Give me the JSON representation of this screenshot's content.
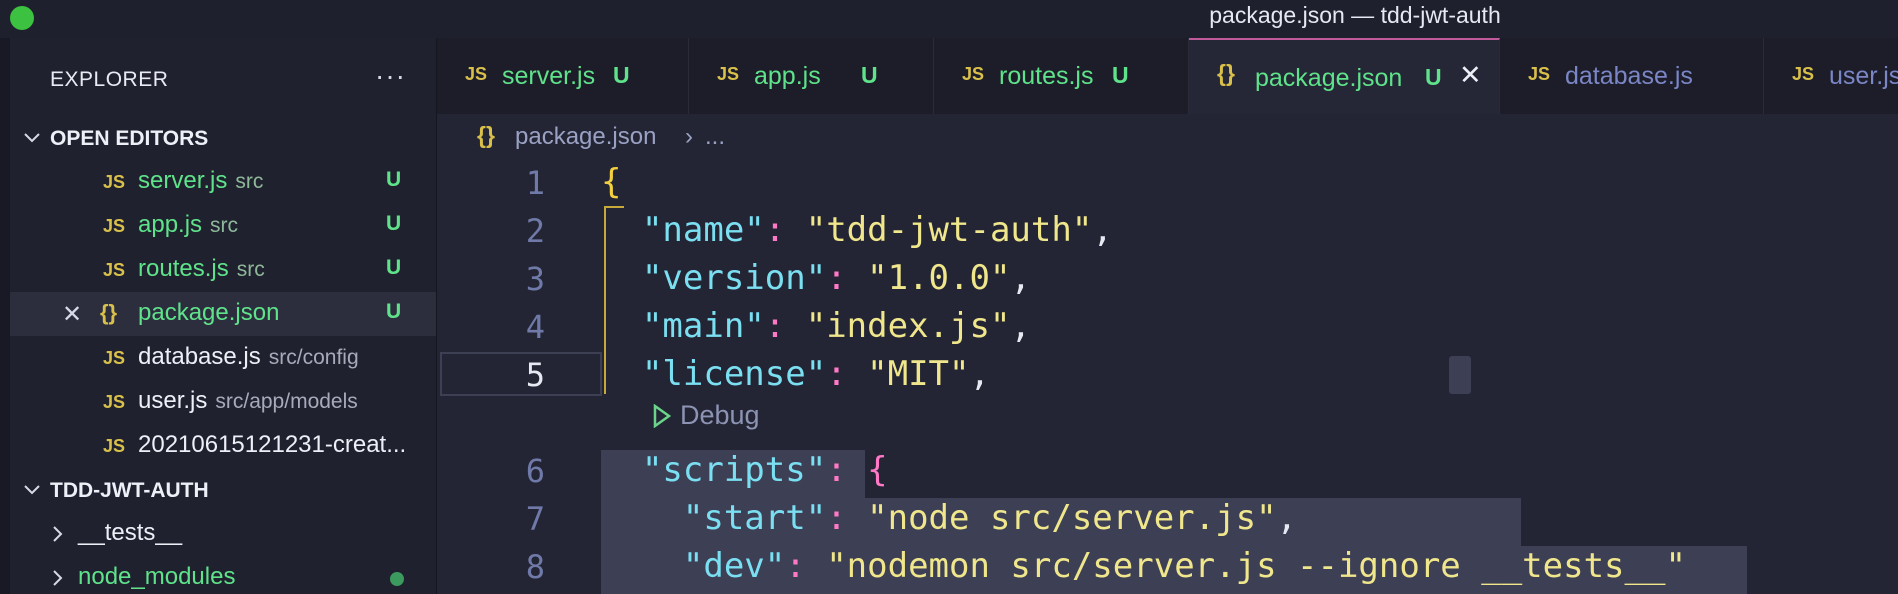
{
  "window": {
    "title": "package.json — tdd-jwt-auth"
  },
  "sidebar": {
    "title": "EXPLORER",
    "more_label": "···",
    "open_editors": {
      "label": "OPEN EDITORS",
      "items": [
        {
          "icon": "JS",
          "name": "server.js",
          "dir": "src",
          "status": "U"
        },
        {
          "icon": "JS",
          "name": "app.js",
          "dir": "src",
          "status": "U"
        },
        {
          "icon": "JS",
          "name": "routes.js",
          "dir": "src",
          "status": "U"
        },
        {
          "icon": "{}",
          "name": "package.json",
          "dir": "",
          "status": "U",
          "close": "✕"
        },
        {
          "icon": "JS",
          "name": "database.js",
          "dir": "src/config",
          "status": ""
        },
        {
          "icon": "JS",
          "name": "user.js",
          "dir": "src/app/models",
          "status": ""
        },
        {
          "icon": "JS",
          "name": "20210615121231-creat...",
          "dir": "",
          "status": ""
        }
      ]
    },
    "project": {
      "label": "TDD-JWT-AUTH",
      "items": [
        {
          "name": "__tests__"
        },
        {
          "name": "node_modules"
        }
      ]
    }
  },
  "tabs": [
    {
      "icon": "JS",
      "name": "server.js",
      "status": "U"
    },
    {
      "icon": "JS",
      "name": "app.js",
      "status": "U"
    },
    {
      "icon": "JS",
      "name": "routes.js",
      "status": "U"
    },
    {
      "icon": "{}",
      "name": "package.json",
      "status": "U",
      "close": "✕"
    },
    {
      "icon": "JS",
      "name": "database.js",
      "status": ""
    },
    {
      "icon": "JS",
      "name": "user.js",
      "status": ""
    }
  ],
  "breadcrumb": {
    "icon": "{}",
    "file": "package.json",
    "sep": "›",
    "rest": "..."
  },
  "editor": {
    "line_numbers": [
      "1",
      "2",
      "3",
      "4",
      "5",
      "6",
      "7",
      "8"
    ],
    "lines": [
      {
        "brace": "{"
      },
      {
        "key": "\"name\"",
        "value": "\"tdd-jwt-auth\""
      },
      {
        "key": "\"version\"",
        "value": "\"1.0.0\""
      },
      {
        "key": "\"main\"",
        "value": "\"index.js\""
      },
      {
        "key": "\"license\"",
        "value": "\"MIT\""
      },
      {
        "key": "\"scripts\"",
        "brace": "{"
      },
      {
        "key": "\"start\"",
        "value": "\"node src/server.js\""
      },
      {
        "key": "\"dev\"",
        "value": "\"nodemon src/server.js --ignore __tests__\""
      }
    ],
    "punct": {
      "colon": ": ",
      "comma": ","
    },
    "codelens": "Debug"
  }
}
